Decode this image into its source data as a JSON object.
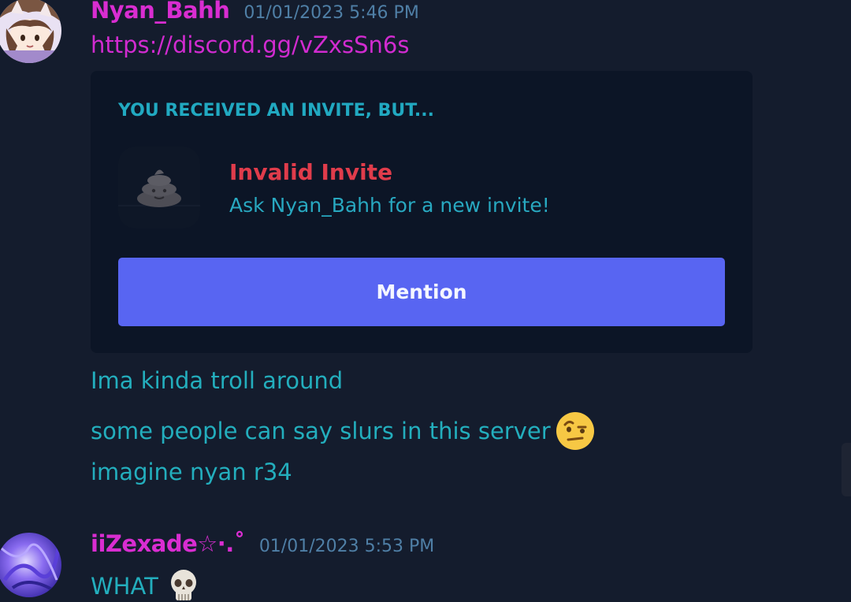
{
  "messages": [
    {
      "username": "Nyan_Bahh",
      "timestamp": "01/01/2023 5:46 PM",
      "link": "https://discord.gg/vZxsSn6s",
      "embed": {
        "header": "YOU RECEIVED AN INVITE, BUT...",
        "title": "Invalid Invite",
        "subtitle": "Ask Nyan_Bahh for a new invite!",
        "button_label": "Mention",
        "icon": "poop-icon"
      },
      "lines": [
        "Ima kinda troll around",
        "some people can say slurs in this server",
        "imagine nyan r34"
      ],
      "line_emoji": "raised-eyebrow-emoji"
    },
    {
      "username": "iiZexade☆·.˚",
      "timestamp": "01/01/2023 5:53 PM",
      "lines": [
        "WHAT"
      ],
      "line_emoji": "skull-emoji"
    }
  ],
  "colors": {
    "background": "#141c2d",
    "username": "#d92dd1",
    "text": "#23aebd",
    "button": "#5865f2",
    "invalid": "#e03c4b"
  }
}
